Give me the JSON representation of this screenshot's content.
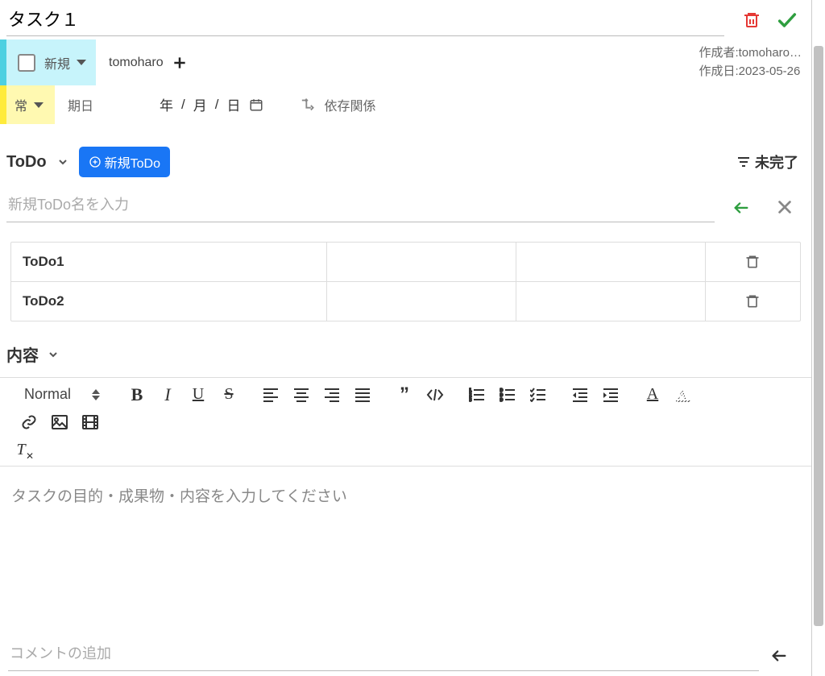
{
  "title": "タスク１",
  "status": {
    "label": "新規"
  },
  "assignee": "tomoharo",
  "creator": {
    "label": "作成者:",
    "value": "tomoharo…"
  },
  "created": {
    "label": "作成日:",
    "value": "2023-05-26"
  },
  "priority": {
    "label": "常"
  },
  "due": {
    "label": "期日",
    "year_ph": "年",
    "sep1": " /",
    "month_ph": "月",
    "sep2": "/",
    "day_ph": "日"
  },
  "dependency_label": "依存関係",
  "todo": {
    "title": "ToDo",
    "new_btn": "新規ToDo",
    "filter_label": "未完了",
    "input_placeholder": "新規ToDo名を入力",
    "rows": [
      {
        "name": "ToDo1"
      },
      {
        "name": "ToDo2"
      }
    ]
  },
  "content": {
    "title": "内容",
    "format_label": "Normal",
    "placeholder": "タスクの目的・成果物・内容を入力してください"
  },
  "comment": {
    "placeholder": "コメントの追加"
  }
}
